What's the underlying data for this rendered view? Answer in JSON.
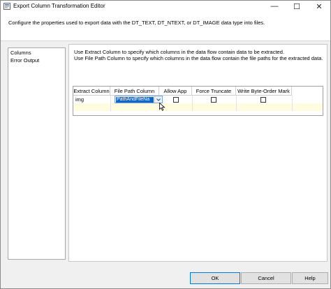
{
  "window": {
    "title": "Export Column Transformation Editor",
    "min_glyph": "—",
    "max_glyph": "☐",
    "close_glyph": "✕"
  },
  "header": {
    "text": "Configure the properties used to export data with the DT_TEXT, DT_NTEXT, or DT_IMAGE data type into files."
  },
  "nav": {
    "items": [
      {
        "label": "Columns"
      },
      {
        "label": "Error Output"
      }
    ]
  },
  "main": {
    "description_1": "Use Extract Column to specify which columns in the data flow contain data to be extracted.",
    "description_2": "Use File Path Column to specify which columns in the data flow contain the file paths for the extracted data."
  },
  "grid": {
    "columns": [
      {
        "label": "Extract Column"
      },
      {
        "label": "File Path Column"
      },
      {
        "label": "Allow App"
      },
      {
        "label": "Force Truncate"
      },
      {
        "label": "Write Byte-Order Mark"
      }
    ],
    "rows": [
      {
        "extract_column": "img",
        "file_path_column": "PathAndFileNa",
        "allow_append": false,
        "force_truncate": false,
        "write_bom": false
      }
    ],
    "new_row_color": "#fffce0",
    "selection_color": "#0e66c8"
  },
  "footer": {
    "ok_label": "OK",
    "cancel_label": "Cancel",
    "help_label": "Help"
  }
}
